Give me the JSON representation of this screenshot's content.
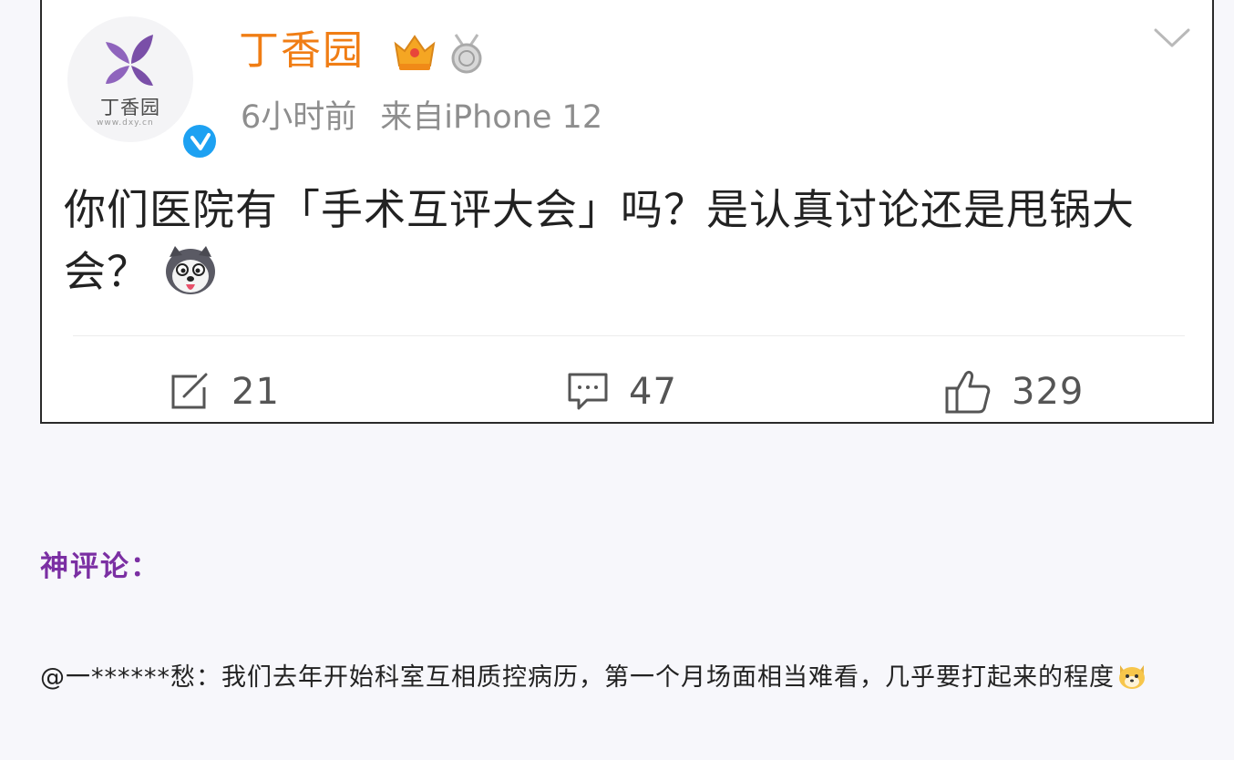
{
  "post": {
    "avatar_text": "丁香园",
    "avatar_subtext": "www.dxy.cn",
    "username": "丁香园",
    "time": "6小时前",
    "source": "来自iPhone 12",
    "content": "你们医院有「手术互评大会」吗？是认真讨论还是甩锅大会？",
    "icons": {
      "logo": "lilac-flower-logo-icon",
      "verified": "verified-check-icon",
      "crown": "crown-badge-icon",
      "medal": "medal-badge-icon",
      "menu": "chevron-down-icon",
      "emoji": "husky-dog-emoji-icon"
    },
    "actions": {
      "repost_count": "21",
      "comment_count": "47",
      "like_count": "329"
    }
  },
  "section": {
    "title": "神评论："
  },
  "comment": {
    "author": "@一******愁：",
    "text": "我们去年开始科室互相质控病历，第一个月场面相当难看，几乎要打起来的程度",
    "emoji": "dog-face-emoji-icon"
  },
  "colors": {
    "username": "#f07d14",
    "section_title": "#7b2fa3",
    "verified": "#1da1f2",
    "logo": "#7a4fa8"
  }
}
